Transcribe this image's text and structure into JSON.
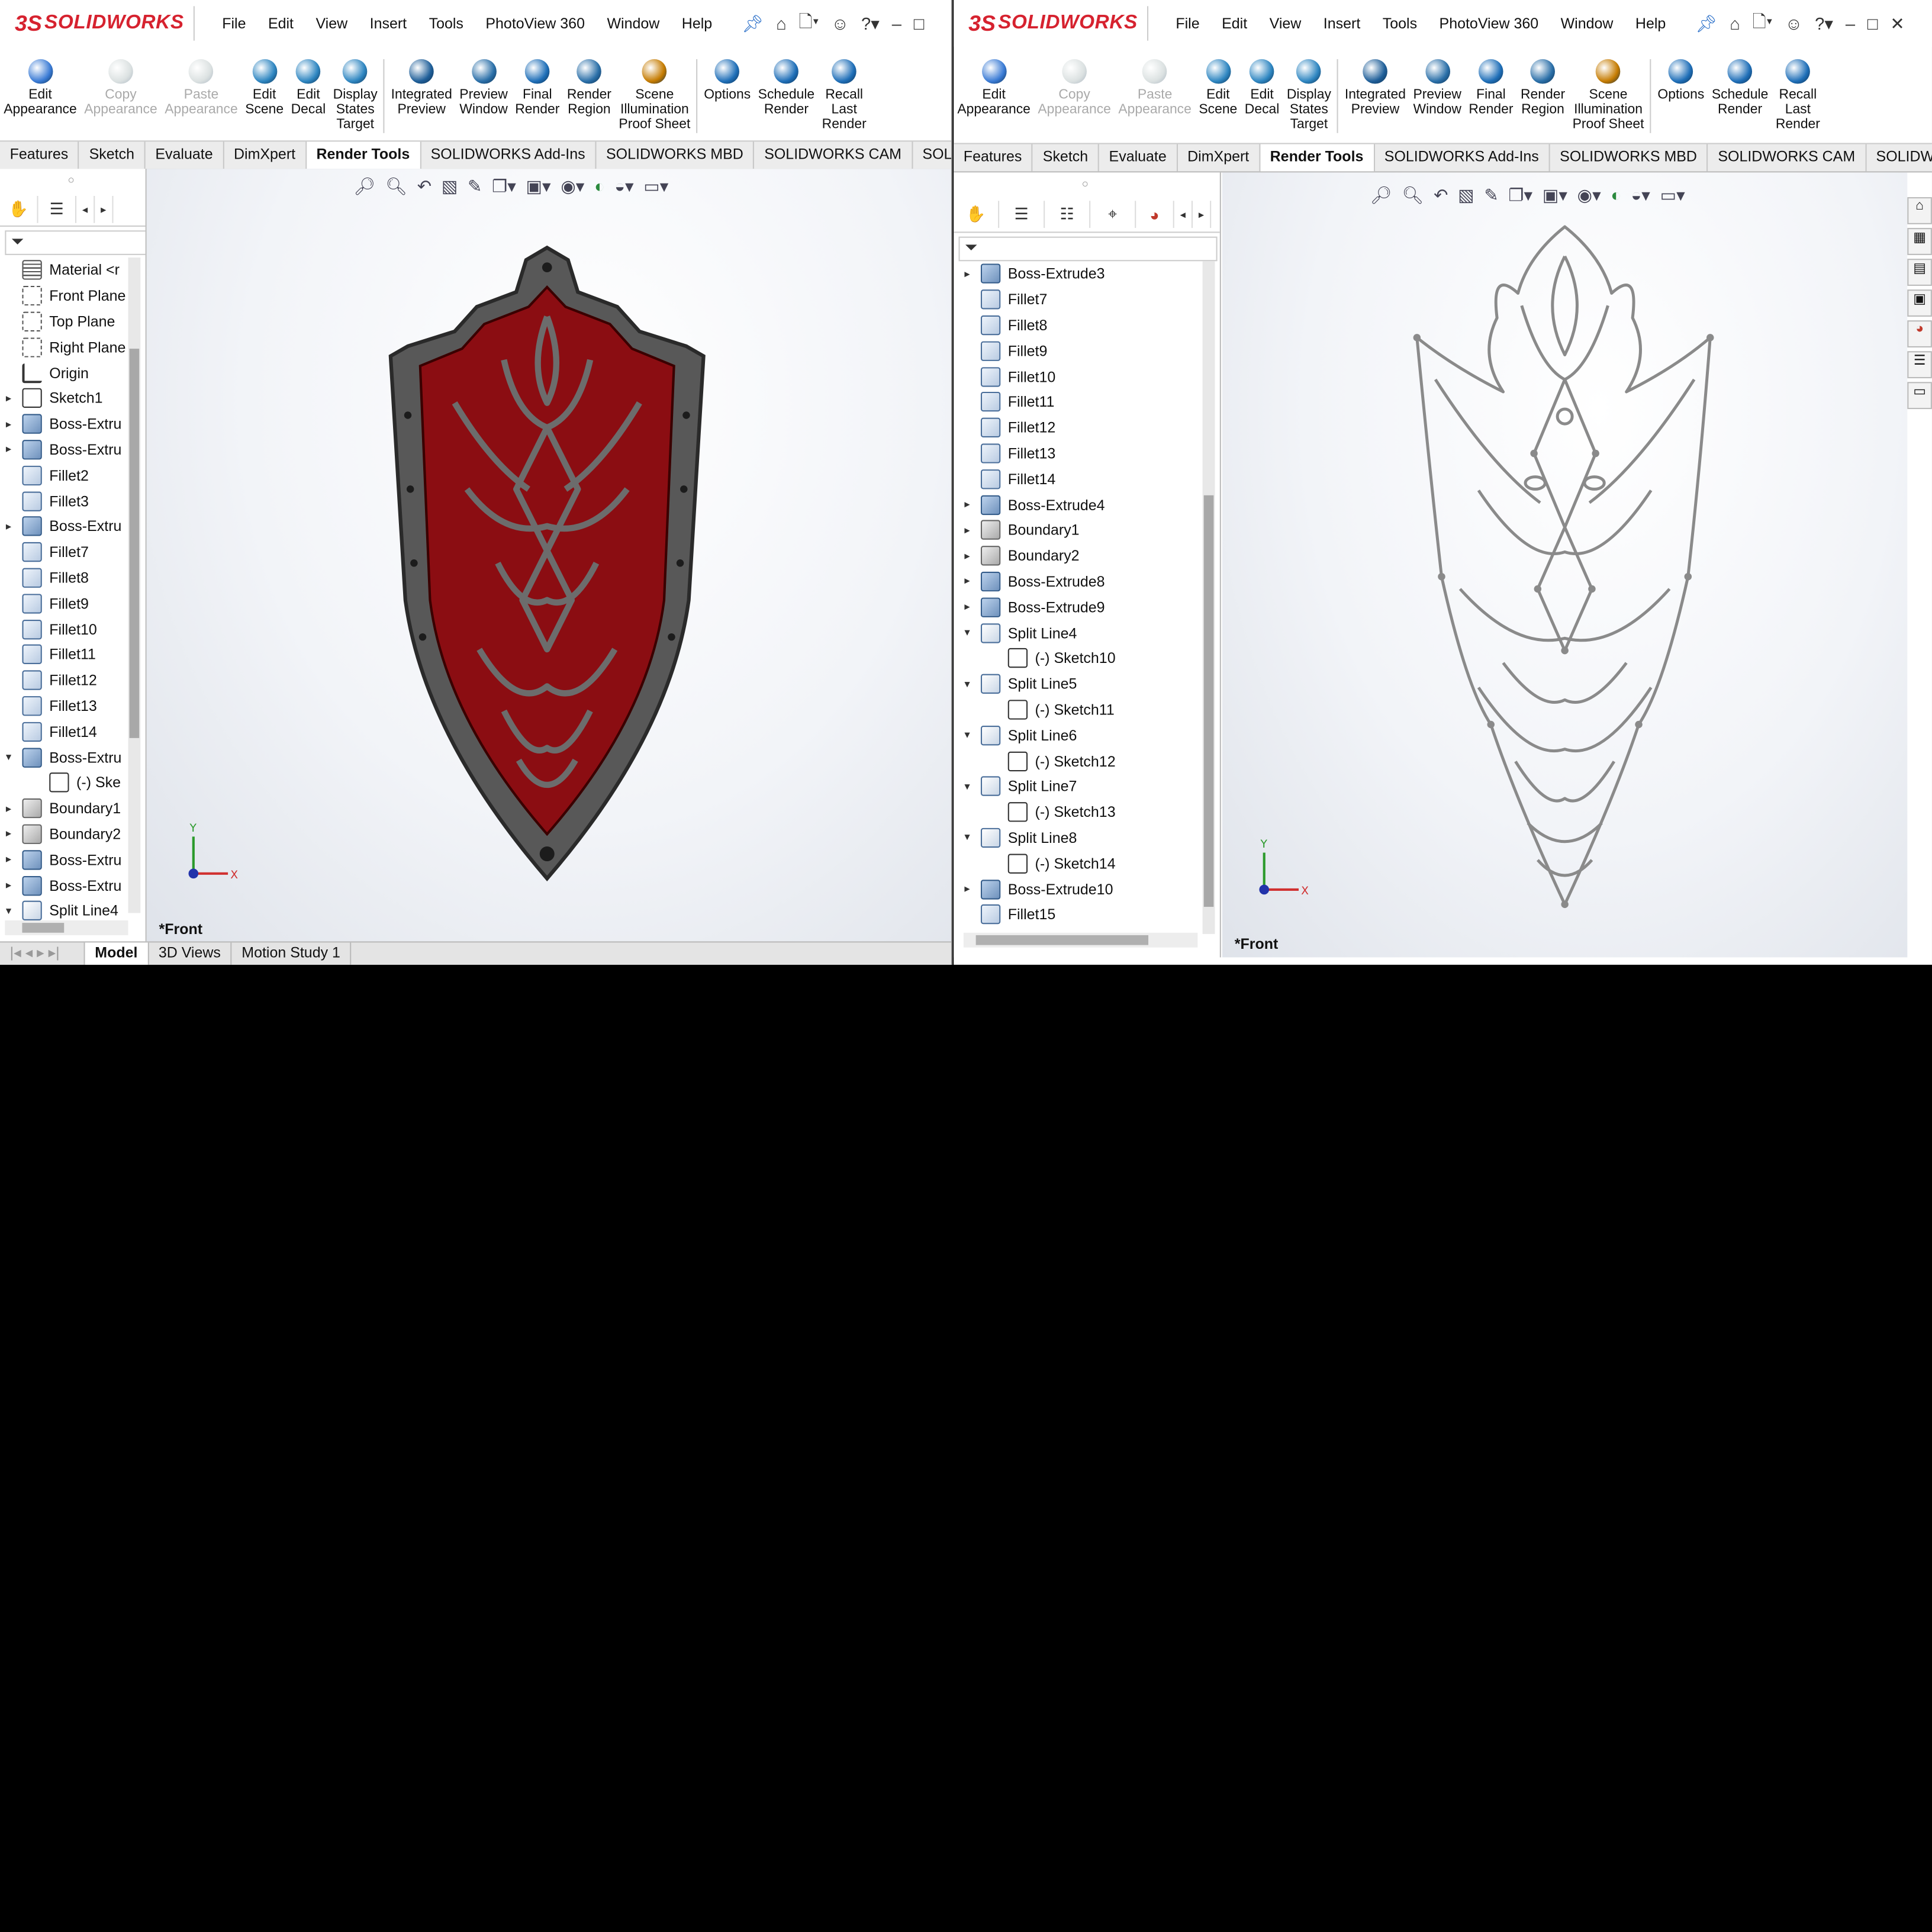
{
  "common": {
    "brand_prefix": "3S",
    "brand": "SOLIDWORKS",
    "menu": [
      "File",
      "Edit",
      "View",
      "Insert",
      "Tools",
      "PhotoView 360",
      "Window",
      "Help"
    ],
    "ribbon": [
      {
        "label": "Edit\nAppearance",
        "icon": "edit-appearance-icon",
        "disabled": false
      },
      {
        "label": "Copy\nAppearance",
        "icon": "copy-appearance-icon",
        "disabled": true
      },
      {
        "label": "Paste\nAppearance",
        "icon": "paste-appearance-icon",
        "disabled": true
      },
      {
        "label": "Edit\nScene",
        "icon": "edit-scene-icon",
        "disabled": false
      },
      {
        "label": "Edit\nDecal",
        "icon": "edit-decal-icon",
        "disabled": false
      },
      {
        "label": "Display\nStates\nTarget",
        "icon": "display-states-icon",
        "disabled": false
      },
      {
        "label": "Integrated\nPreview",
        "icon": "integrated-preview-icon",
        "disabled": false
      },
      {
        "label": "Preview\nWindow",
        "icon": "preview-window-icon",
        "disabled": false
      },
      {
        "label": "Final\nRender",
        "icon": "final-render-icon",
        "disabled": false
      },
      {
        "label": "Render\nRegion",
        "icon": "render-region-icon",
        "disabled": false
      },
      {
        "label": "Scene\nIllumination\nProof Sheet",
        "icon": "scene-illumination-icon",
        "disabled": false
      },
      {
        "label": "Options",
        "icon": "options-icon",
        "disabled": false
      },
      {
        "label": "Schedule\nRender",
        "icon": "schedule-render-icon",
        "disabled": false
      },
      {
        "label": "Recall\nLast\nRender",
        "icon": "recall-render-icon",
        "disabled": false
      }
    ],
    "tabs": [
      "Features",
      "Sketch",
      "Evaluate",
      "DimXpert",
      "Render Tools",
      "SOLIDWORKS Add-Ins",
      "SOLIDWORKS MBD",
      "SOLIDWORKS CAM"
    ],
    "active_tab": "Render Tools",
    "view_label": "*Front",
    "colors": {
      "brand_red": "#d6222f",
      "shield_red": "#8b0d12",
      "shield_metal": "#585858",
      "sketch_gray": "#8a8a8a"
    }
  },
  "left": {
    "tab_last": "SOLIDWORKS Inspecti",
    "tree": [
      {
        "label": "Material <r",
        "expand": "",
        "icon": "material-icon"
      },
      {
        "label": "Front Plane",
        "expand": "",
        "icon": "plane-icon"
      },
      {
        "label": "Top Plane",
        "expand": "",
        "icon": "plane-icon"
      },
      {
        "label": "Right Plane",
        "expand": "",
        "icon": "plane-icon"
      },
      {
        "label": "Origin",
        "expand": "",
        "icon": "origin-icon"
      },
      {
        "label": "Sketch1",
        "expand": "▸",
        "icon": "sketch-icon"
      },
      {
        "label": "Boss-Extru",
        "expand": "▸",
        "icon": "extrude-icon"
      },
      {
        "label": "Boss-Extru",
        "expand": "▸",
        "icon": "extrude-icon"
      },
      {
        "label": "Fillet2",
        "expand": "",
        "icon": "fillet-icon"
      },
      {
        "label": "Fillet3",
        "expand": "",
        "icon": "fillet-icon"
      },
      {
        "label": "Boss-Extru",
        "expand": "▸",
        "icon": "extrude-icon"
      },
      {
        "label": "Fillet7",
        "expand": "",
        "icon": "fillet-icon"
      },
      {
        "label": "Fillet8",
        "expand": "",
        "icon": "fillet-icon"
      },
      {
        "label": "Fillet9",
        "expand": "",
        "icon": "fillet-icon"
      },
      {
        "label": "Fillet10",
        "expand": "",
        "icon": "fillet-icon"
      },
      {
        "label": "Fillet11",
        "expand": "",
        "icon": "fillet-icon"
      },
      {
        "label": "Fillet12",
        "expand": "",
        "icon": "fillet-icon"
      },
      {
        "label": "Fillet13",
        "expand": "",
        "icon": "fillet-icon"
      },
      {
        "label": "Fillet14",
        "expand": "",
        "icon": "fillet-icon"
      },
      {
        "label": "Boss-Extru",
        "expand": "▾",
        "icon": "extrude-icon"
      },
      {
        "label": "(-) Ske",
        "expand": "",
        "icon": "sketch-icon",
        "child": true
      },
      {
        "label": "Boundary1",
        "expand": "▸",
        "icon": "boundary-icon"
      },
      {
        "label": "Boundary2",
        "expand": "▸",
        "icon": "boundary-icon"
      },
      {
        "label": "Boss-Extru",
        "expand": "▸",
        "icon": "extrude-icon"
      },
      {
        "label": "Boss-Extru",
        "expand": "▸",
        "icon": "extrude-icon"
      },
      {
        "label": "Split Line4",
        "expand": "▾",
        "icon": "split-line-icon"
      }
    ],
    "bottom_tabs": [
      "Model",
      "3D Views",
      "Motion Study 1"
    ],
    "active_bottom_tab": "Model"
  },
  "right": {
    "tab_last": "SOLIDWORKS Inspection",
    "tree": [
      {
        "label": "Boss-Extrude3",
        "expand": "▸",
        "icon": "extrude-icon"
      },
      {
        "label": "Fillet7",
        "expand": "",
        "icon": "fillet-icon"
      },
      {
        "label": "Fillet8",
        "expand": "",
        "icon": "fillet-icon"
      },
      {
        "label": "Fillet9",
        "expand": "",
        "icon": "fillet-icon"
      },
      {
        "label": "Fillet10",
        "expand": "",
        "icon": "fillet-icon"
      },
      {
        "label": "Fillet11",
        "expand": "",
        "icon": "fillet-icon"
      },
      {
        "label": "Fillet12",
        "expand": "",
        "icon": "fillet-icon"
      },
      {
        "label": "Fillet13",
        "expand": "",
        "icon": "fillet-icon"
      },
      {
        "label": "Fillet14",
        "expand": "",
        "icon": "fillet-icon"
      },
      {
        "label": "Boss-Extrude4",
        "expand": "▸",
        "icon": "extrude-icon"
      },
      {
        "label": "Boundary1",
        "expand": "▸",
        "icon": "boundary-icon"
      },
      {
        "label": "Boundary2",
        "expand": "▸",
        "icon": "boundary-icon"
      },
      {
        "label": "Boss-Extrude8",
        "expand": "▸",
        "icon": "extrude-icon"
      },
      {
        "label": "Boss-Extrude9",
        "expand": "▸",
        "icon": "extrude-icon"
      },
      {
        "label": "Split Line4",
        "expand": "▾",
        "icon": "split-line-icon"
      },
      {
        "label": "(-) Sketch10",
        "expand": "",
        "icon": "sketch-icon",
        "child": true
      },
      {
        "label": "Split Line5",
        "expand": "▾",
        "icon": "split-line-icon"
      },
      {
        "label": "(-) Sketch11",
        "expand": "",
        "icon": "sketch-icon",
        "child": true
      },
      {
        "label": "Split Line6",
        "expand": "▾",
        "icon": "split-line-icon"
      },
      {
        "label": "(-) Sketch12",
        "expand": "",
        "icon": "sketch-icon",
        "child": true
      },
      {
        "label": "Split Line7",
        "expand": "▾",
        "icon": "split-line-icon"
      },
      {
        "label": "(-) Sketch13",
        "expand": "",
        "icon": "sketch-icon",
        "child": true
      },
      {
        "label": "Split Line8",
        "expand": "▾",
        "icon": "split-line-icon"
      },
      {
        "label": "(-) Sketch14",
        "expand": "",
        "icon": "sketch-icon",
        "child": true
      },
      {
        "label": "Boss-Extrude10",
        "expand": "▸",
        "icon": "extrude-icon"
      },
      {
        "label": "Fillet15",
        "expand": "",
        "icon": "fillet-icon"
      }
    ]
  }
}
